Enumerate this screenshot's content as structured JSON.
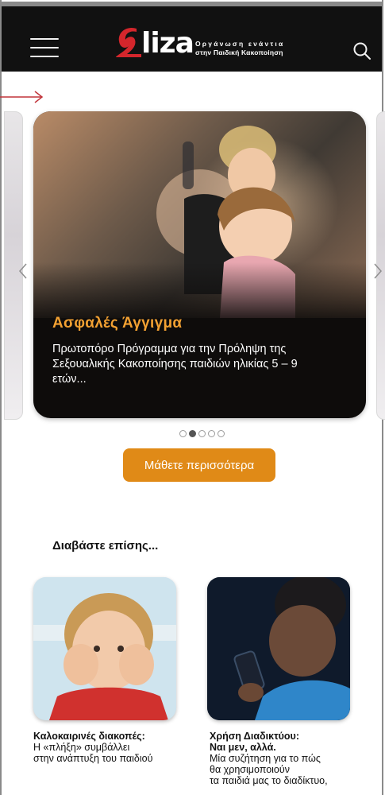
{
  "header": {
    "logo_word": "liza",
    "logo_tag_line1": "Οργάνωση ενάντια",
    "logo_tag_line2": "στην Παιδική Κακοποίηση"
  },
  "carousel": {
    "slide_title": "Ασφαλές Άγγιγμα",
    "slide_text": "Πρωτοπόρο Πρόγραμμα για την Πρόληψη της Σεξουαλικής Κακοποίησης παιδιών ηλικίας 5 – 9 ετών...",
    "dots_count": 5,
    "active_dot": 2
  },
  "cta": {
    "label": "Μάθετε περισσότερα"
  },
  "read_also": {
    "title": "Διαβάστε επίσης...",
    "cards": [
      {
        "title": "Καλοκαιρινές διακοπές:",
        "text_line1": "Η «πλήξη» συμβάλλει",
        "text_line2": "στην ανάπτυξη του παιδιού"
      },
      {
        "title_line1": "Χρήση Διαδικτύου:",
        "title_line2": "Ναι μεν, αλλά.",
        "text_line1": "Μία συζήτηση για το πώς",
        "text_line2": "θα χρησιμοποιούν",
        "text_line3": "τα παιδιά μας το διαδίκτυο,"
      }
    ]
  },
  "colors": {
    "brand_red": "#d4262c",
    "accent_orange": "#e08a17",
    "slide_title_orange": "#f3a132",
    "header_bg": "#111111"
  },
  "icons": {
    "menu": "hamburger-icon",
    "search": "search-icon",
    "arrow": "arrow-right-icon",
    "prev": "chevron-left-icon",
    "next": "chevron-right-icon"
  }
}
